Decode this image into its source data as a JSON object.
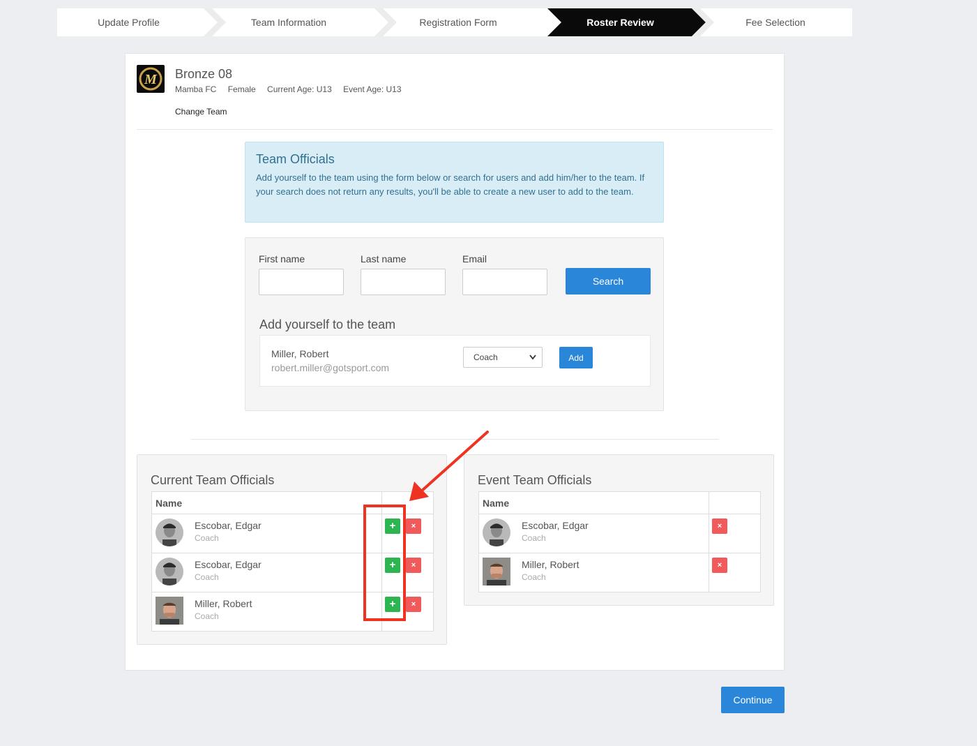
{
  "steps": [
    "Update Profile",
    "Team Information",
    "Registration Form",
    "Roster Review",
    "Fee Selection"
  ],
  "colors": {
    "accent": "#2a86d9",
    "add_green": "#2db552",
    "remove_red": "#f05a5a",
    "info_bg": "#d9edf7",
    "annotation": "#ee3322"
  },
  "team": {
    "name": "Bronze 08",
    "club": "Mamba FC",
    "gender": "Female",
    "current_age": "Current Age: U13",
    "event_age": "Event Age: U13",
    "change_label": "Change Team",
    "logo_letter": "M"
  },
  "info": {
    "title": "Team Officials",
    "text": "Add yourself to the team using the form below or search for users and add him/her to the team. If your search does not return any results, you'll be able to create a new user to add to the team."
  },
  "search": {
    "first_label": "First name",
    "last_label": "Last name",
    "email_label": "Email",
    "button": "Search"
  },
  "add_self": {
    "title": "Add yourself to the team",
    "name": "Miller, Robert",
    "email": "robert.miller@gotsport.com",
    "role": "Coach",
    "button": "Add"
  },
  "current": {
    "title": "Current Team Officials",
    "col_name": "Name",
    "rows": [
      {
        "name": "Escobar, Edgar",
        "role": "Coach"
      },
      {
        "name": "Escobar, Edgar",
        "role": "Coach"
      },
      {
        "name": "Miller, Robert",
        "role": "Coach"
      }
    ]
  },
  "event": {
    "title": "Event Team Officials",
    "col_name": "Name",
    "rows": [
      {
        "name": "Escobar, Edgar",
        "role": "Coach"
      },
      {
        "name": "Miller, Robert",
        "role": "Coach"
      }
    ]
  },
  "icons": {
    "add": "+",
    "remove": "×",
    "dropdown": "chevron-down-icon"
  },
  "continue": "Continue"
}
